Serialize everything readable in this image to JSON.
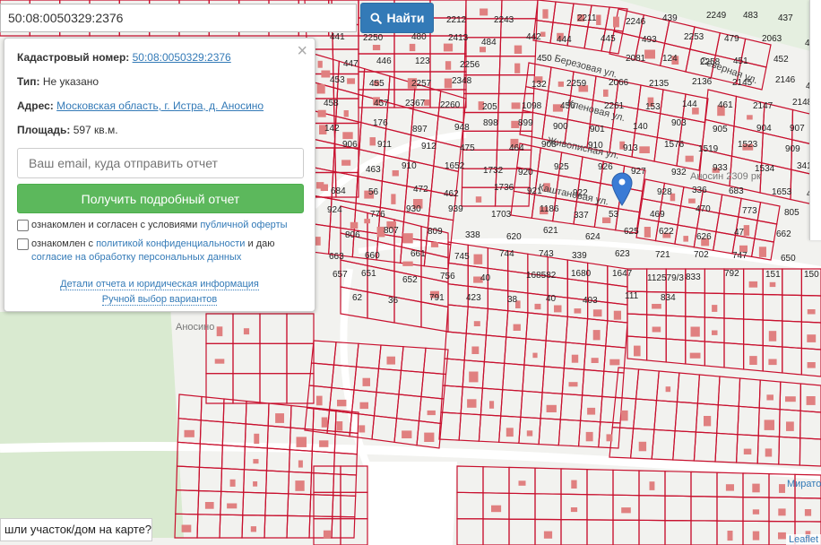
{
  "search": {
    "value": "50:08:0050329:2376",
    "button_label": "Найти"
  },
  "panel": {
    "cadastral_label": "Кадастровый номер:",
    "cadastral_value": "50:08:0050329:2376",
    "type_label": "Тип:",
    "type_value": "Не указано",
    "address_label": "Адрес:",
    "address_value": "Московская область, г. Истра, д. Аносино",
    "area_label": "Площадь:",
    "area_value": "597 кв.м.",
    "email_placeholder": "Ваш email, куда отправить отчет",
    "report_button": "Получить подробный отчет",
    "consent1_text": "ознакомлен и согласен с условиями",
    "consent1_link": "публичной оферты",
    "consent2_text_a": "ознакомлен с",
    "consent2_link_a": "политикой конфиденциальности",
    "consent2_text_b": "и даю",
    "consent2_link_b": "согласие на обработку персональных данных",
    "details_link": "Детали отчета и юридическая информация",
    "manual_link": "Ручной выбор вариантов"
  },
  "bottom_bar": {
    "text": "шли участок/дом на карте?"
  },
  "attribution": "Leaflet",
  "colors": {
    "parcel_stroke": "#c8102e",
    "map_background": "#f2f2ef",
    "green_area": "#d9ead0",
    "building": "#e08080",
    "marker": "#3a7bd5",
    "primary": "#337ab7",
    "success": "#5cb85c"
  },
  "map": {
    "streets": [
      "Северная ул.",
      "Березовая ул.",
      "Кленовая ул.",
      "Живописная ул.",
      "Каштановая ул.",
      "Аносин 2309 рк"
    ],
    "places": [
      "Аносино",
      "Мирато"
    ],
    "parcel_labels": [
      "433",
      "436",
      "2212",
      "2243",
      "2211",
      "2246",
      "439",
      "2249",
      "483",
      "437",
      "435",
      "441",
      "2250",
      "480",
      "2413",
      "484",
      "442",
      "444",
      "445",
      "493",
      "2253",
      "479",
      "2063",
      "449",
      "447",
      "446",
      "123",
      "2256",
      "450",
      "2081",
      "124",
      "2258",
      "451",
      "452",
      "453",
      "455",
      "2257",
      "2348",
      "132",
      "2259",
      "2066",
      "2135",
      "2136",
      "2145",
      "2146",
      "459",
      "458",
      "457",
      "2367",
      "2260",
      "205",
      "1098",
      "456",
      "2261",
      "153",
      "144",
      "461",
      "2147",
      "2148",
      "142",
      "176",
      "897",
      "948",
      "898",
      "899",
      "900",
      "901",
      "140",
      "903",
      "905",
      "904",
      "907",
      "906",
      "911",
      "912",
      "475",
      "464",
      "908",
      "910",
      "913",
      "1576",
      "1519",
      "1523",
      "909",
      "463",
      "910",
      "1652",
      "1732",
      "920",
      "925",
      "926",
      "927",
      "932",
      "933",
      "1534",
      "341",
      "684",
      "56",
      "472",
      "462",
      "1736",
      "921",
      "922",
      "929",
      "928",
      "336",
      "683",
      "1653",
      "474",
      "924",
      "776",
      "930",
      "939",
      "1703",
      "1186",
      "337",
      "53",
      "469",
      "470",
      "773",
      "805",
      "806",
      "807",
      "809",
      "338",
      "620",
      "621",
      "624",
      "625",
      "622",
      "626",
      "47",
      "662",
      "663",
      "660",
      "661",
      "745",
      "744",
      "743",
      "339",
      "623",
      "721",
      "702",
      "747",
      "650",
      "657",
      "651",
      "652",
      "756",
      "40",
      "168582",
      "1680",
      "1647",
      "112579/3",
      "833",
      "792",
      "151",
      "150",
      "62",
      "36",
      "791",
      "423",
      "38",
      "40",
      "403",
      "111",
      "834"
    ]
  }
}
